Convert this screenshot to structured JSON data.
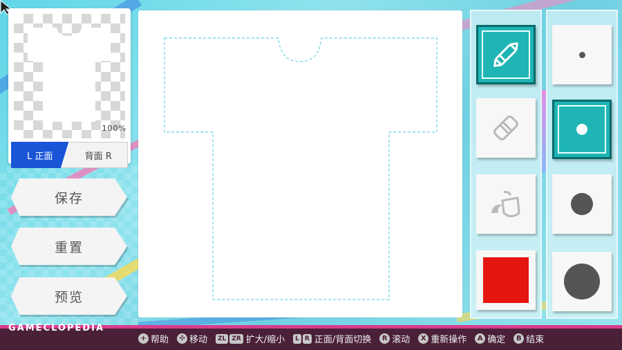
{
  "preview": {
    "zoom": "100%",
    "tab_front": "L 正面",
    "tab_back": "背面 R"
  },
  "actions": {
    "save": "保存",
    "reset": "重置",
    "preview": "预览"
  },
  "tools": {
    "pen": "pen-icon",
    "eraser": "eraser-icon",
    "fill": "bucket-fill-icon",
    "color": "#e4160f",
    "selected_tool": "pen"
  },
  "brush_sizes": {
    "options": [
      "tiny",
      "small",
      "medium",
      "large"
    ],
    "selected": "small"
  },
  "brand": "GAMECLOPEDIA",
  "hints": {
    "help": "帮助",
    "move": "移动",
    "zoom_buttons": [
      "ZL",
      "ZR"
    ],
    "zoom": "扩大/缩小",
    "side_buttons": [
      "L",
      "R"
    ],
    "switch_side": "正面/背面切换",
    "scroll_button": "R",
    "scroll": "滚动",
    "redo_button": "X",
    "redo": "重新操作",
    "confirm_button": "A",
    "confirm": "确定",
    "end_button": "B",
    "end": "结束"
  },
  "colors": {
    "accent_teal": "#1fb5b5",
    "tab_blue": "#1a55d8",
    "bottom_bar": "#4a1f38",
    "stencil": "#7fd8e6"
  }
}
